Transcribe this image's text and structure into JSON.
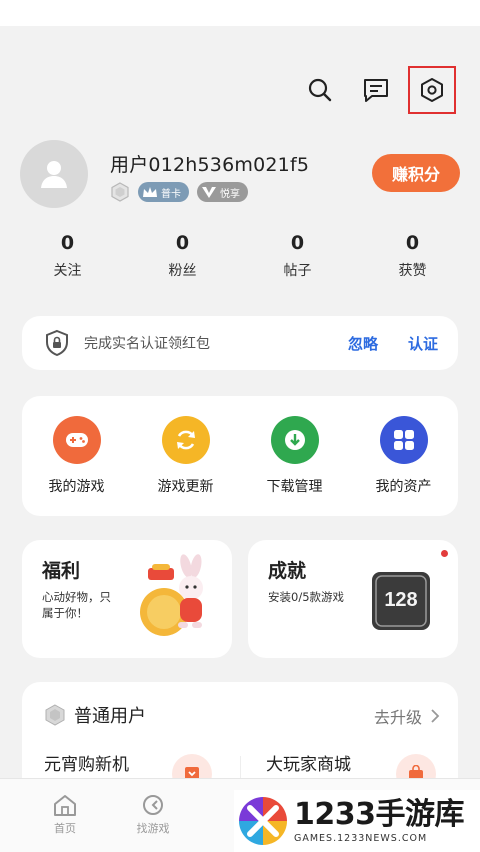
{
  "top_icons": {
    "search": "search-icon",
    "message": "message-icon",
    "settings": "settings-icon"
  },
  "profile": {
    "username": "用户012h536m021f5",
    "badges": [
      {
        "label": "普卡"
      },
      {
        "label": "悦享"
      }
    ],
    "earn_button": "赚积分"
  },
  "stats": [
    {
      "value": "0",
      "label": "关注"
    },
    {
      "value": "0",
      "label": "粉丝"
    },
    {
      "value": "0",
      "label": "帖子"
    },
    {
      "value": "0",
      "label": "获赞"
    }
  ],
  "verify": {
    "text": "完成实名认证领红包",
    "ignore": "忽略",
    "certify": "认证"
  },
  "quick_actions": [
    {
      "label": "我的游戏",
      "color": "#f06a3c"
    },
    {
      "label": "游戏更新",
      "color": "#f5b626"
    },
    {
      "label": "下载管理",
      "color": "#2fa84f"
    },
    {
      "label": "我的资产",
      "color": "#3a56d8"
    }
  ],
  "welfare": {
    "title": "福利",
    "subtitle": "心动好物，只属于你！"
  },
  "achievement": {
    "title": "成就",
    "subtitle": "安装0/5款游戏",
    "badge_text": "128"
  },
  "membership": {
    "title": "普通用户",
    "upgrade": "去升级",
    "items": [
      "元宵购新机",
      "大玩家商城"
    ]
  },
  "bottom_nav": [
    {
      "label": "首页"
    },
    {
      "label": "找游戏"
    }
  ],
  "watermark": {
    "brand": "1233手游库",
    "url": "GAMES.1233NEWS.COM"
  },
  "colors": {
    "accent_orange": "#f2703a",
    "link_blue": "#2d6be0",
    "highlight_red": "#e03030"
  }
}
